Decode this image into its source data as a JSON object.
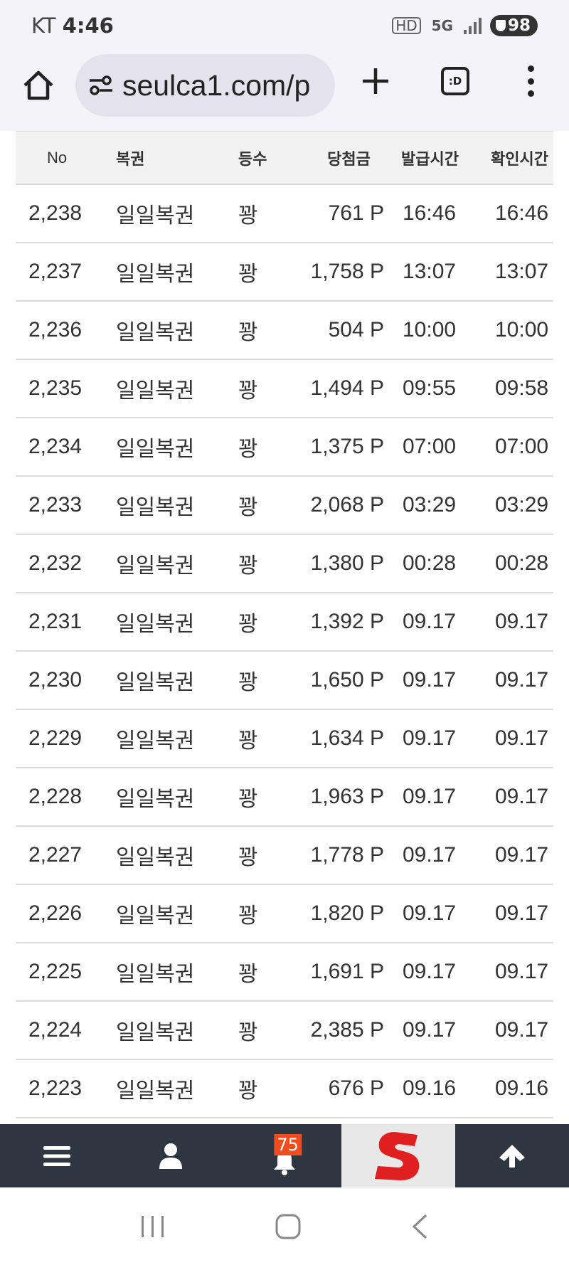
{
  "status_bar": {
    "carrier": "KT",
    "time": "4:46",
    "hd": "HD",
    "network": "5G",
    "battery": "98"
  },
  "browser": {
    "url": "seulca1.com/p",
    "tabs_label": ":D"
  },
  "table": {
    "headers": {
      "no": "No",
      "name": "복권",
      "rank": "등수",
      "amount": "당첨금",
      "issued": "발급시간",
      "checked": "확인시간"
    },
    "rows": [
      {
        "no": "2,238",
        "name": "일일복권",
        "rank": "꽝",
        "amount": "761 P",
        "issued": "16:46",
        "checked": "16:46"
      },
      {
        "no": "2,237",
        "name": "일일복권",
        "rank": "꽝",
        "amount": "1,758 P",
        "issued": "13:07",
        "checked": "13:07"
      },
      {
        "no": "2,236",
        "name": "일일복권",
        "rank": "꽝",
        "amount": "504 P",
        "issued": "10:00",
        "checked": "10:00"
      },
      {
        "no": "2,235",
        "name": "일일복권",
        "rank": "꽝",
        "amount": "1,494 P",
        "issued": "09:55",
        "checked": "09:58"
      },
      {
        "no": "2,234",
        "name": "일일복권",
        "rank": "꽝",
        "amount": "1,375 P",
        "issued": "07:00",
        "checked": "07:00"
      },
      {
        "no": "2,233",
        "name": "일일복권",
        "rank": "꽝",
        "amount": "2,068 P",
        "issued": "03:29",
        "checked": "03:29"
      },
      {
        "no": "2,232",
        "name": "일일복권",
        "rank": "꽝",
        "amount": "1,380 P",
        "issued": "00:28",
        "checked": "00:28"
      },
      {
        "no": "2,231",
        "name": "일일복권",
        "rank": "꽝",
        "amount": "1,392 P",
        "issued": "09.17",
        "checked": "09.17"
      },
      {
        "no": "2,230",
        "name": "일일복권",
        "rank": "꽝",
        "amount": "1,650 P",
        "issued": "09.17",
        "checked": "09.17"
      },
      {
        "no": "2,229",
        "name": "일일복권",
        "rank": "꽝",
        "amount": "1,634 P",
        "issued": "09.17",
        "checked": "09.17"
      },
      {
        "no": "2,228",
        "name": "일일복권",
        "rank": "꽝",
        "amount": "1,963 P",
        "issued": "09.17",
        "checked": "09.17"
      },
      {
        "no": "2,227",
        "name": "일일복권",
        "rank": "꽝",
        "amount": "1,778 P",
        "issued": "09.17",
        "checked": "09.17"
      },
      {
        "no": "2,226",
        "name": "일일복권",
        "rank": "꽝",
        "amount": "1,820 P",
        "issued": "09.17",
        "checked": "09.17"
      },
      {
        "no": "2,225",
        "name": "일일복권",
        "rank": "꽝",
        "amount": "1,691 P",
        "issued": "09.17",
        "checked": "09.17"
      },
      {
        "no": "2,224",
        "name": "일일복권",
        "rank": "꽝",
        "amount": "2,385 P",
        "issued": "09.17",
        "checked": "09.17"
      },
      {
        "no": "2,223",
        "name": "일일복권",
        "rank": "꽝",
        "amount": "676 P",
        "issued": "09.16",
        "checked": "09.16"
      }
    ]
  },
  "bottom_nav": {
    "items": [
      {
        "icon": "hamburger-menu-icon"
      },
      {
        "icon": "user-icon"
      },
      {
        "icon": "bell-icon",
        "badge": "75"
      },
      {
        "icon": "site-logo-icon"
      },
      {
        "icon": "arrow-up-icon"
      }
    ]
  },
  "colors": {
    "nav_bg": "#2e3741",
    "badge": "#f04c1e",
    "logo_red": "#e02020",
    "browser_bg": "#f4f3f9",
    "url_bg": "#e4e2ec"
  }
}
